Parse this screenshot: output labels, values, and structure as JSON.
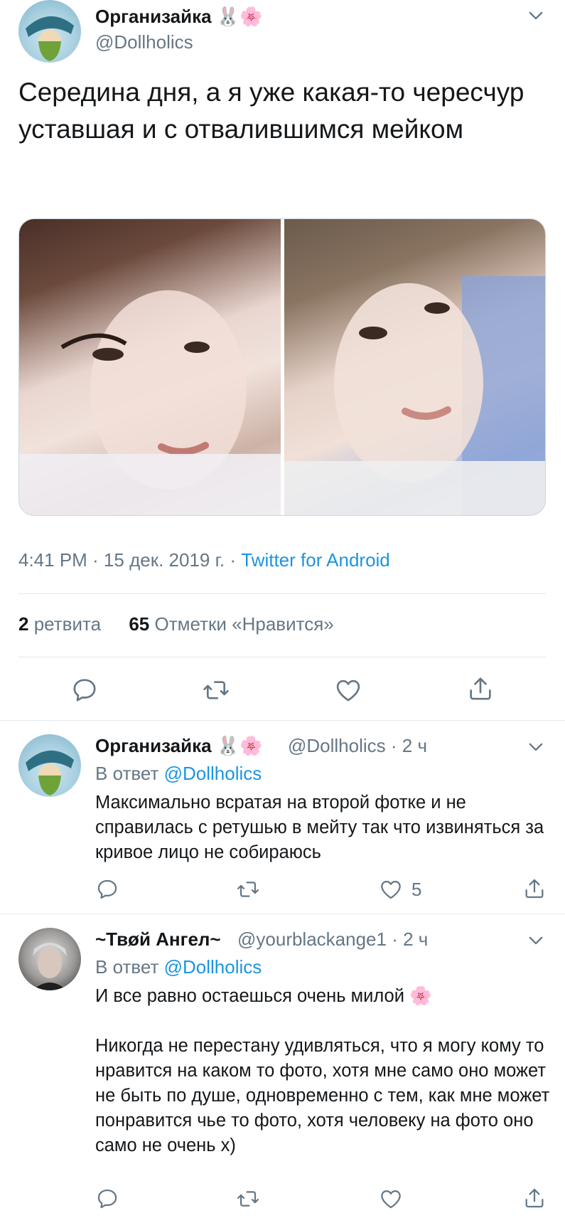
{
  "main_tweet": {
    "author_name": "Организайка 🐰🌸",
    "author_handle": "@Dollholics",
    "text": "Середина дня, а я уже какая-то чересчур уставшая и с отвалившимся мейком",
    "timestamp": "4:41 PM · 15 дек. 2019 г. · ",
    "source": "Twitter for Android",
    "retweet_count": "2",
    "retweet_label": "ретвита",
    "like_count": "65",
    "like_label": "Отметки «Нравится»"
  },
  "replies": [
    {
      "author_name": "Организайка 🐰🌸",
      "author_handle": "@Dollholics · 2 ч",
      "reply_prefix": "В ответ ",
      "reply_to": "@Dollholics",
      "text": "Максимально всратая на второй фотке и не справилась с ретушью в мейту так что извиняться за кривое лицо не собираюсь",
      "like_count": "5"
    },
    {
      "author_name": "~Твøй Ангел~",
      "author_handle": "@yourblackange1 · 2 ч",
      "reply_prefix": "В ответ ",
      "reply_to": "@Dollholics",
      "text": "И все равно остаешься очень милой 🌸\n\nНикогда не перестану удивляться, что я могу кому то нравится на каком то фото, хотя мне само оно может не быть по душе, одновременно с тем, как мне может понравится чье то фото, хотя человеку на фото оно само не очень х)",
      "like_count": ""
    }
  ],
  "icons": {
    "reply": "reply-icon",
    "retweet": "retweet-icon",
    "like": "heart-icon",
    "share": "share-icon",
    "menu": "chevron-down-icon"
  },
  "colors": {
    "link": "#1b95e0",
    "secondary_text": "#657786",
    "divider": "#e1e8ed"
  }
}
